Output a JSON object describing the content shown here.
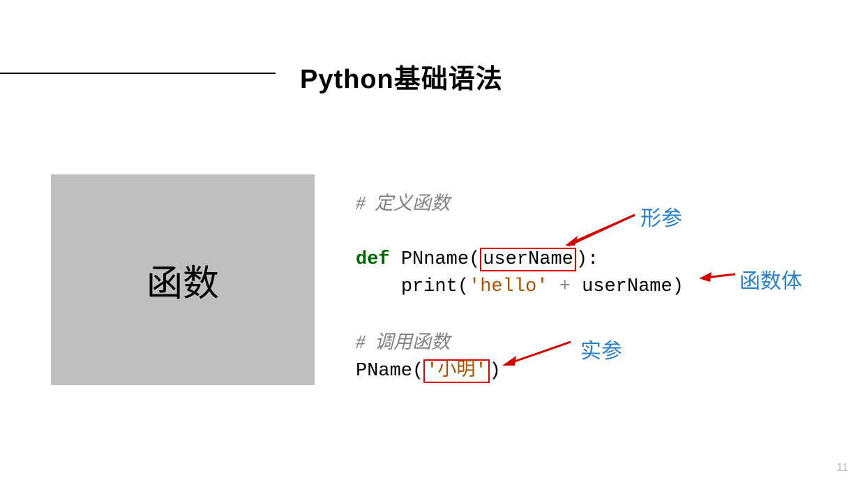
{
  "title": "Python基础语法",
  "sidebar_label": "函数",
  "code": {
    "comment_define": "#  定义函数",
    "kw_def": "def",
    "func_def_name": "PNname",
    "param_name": "userName",
    "print_call": "print",
    "str_hello": "'hello'",
    "plus": " + ",
    "param_ref": "userName",
    "comment_call": "#  调用函数",
    "func_call_name": "PName",
    "arg_value": "'小明'"
  },
  "annotations": {
    "formal_param": "形参",
    "function_body": "函数体",
    "actual_param": "实参"
  },
  "page_number": "11"
}
